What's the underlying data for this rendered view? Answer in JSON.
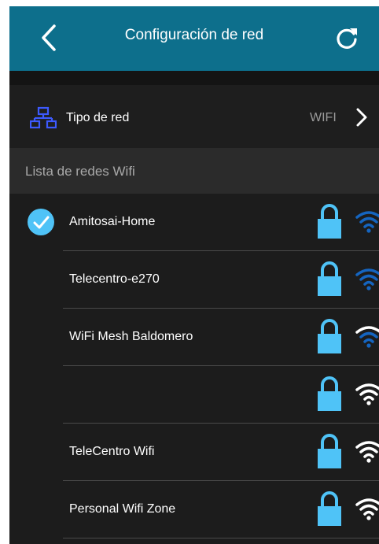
{
  "appbar": {
    "title": "Configuración de red",
    "back_icon": "chevron-left-icon",
    "refresh_icon": "refresh-icon"
  },
  "network_type": {
    "label": "Tipo de red",
    "value": "WIFI",
    "icon": "network-icon"
  },
  "section": {
    "title": "Lista de redes Wifi"
  },
  "colors": {
    "appbar": "#0d6f8c",
    "background": "#1c1c1c",
    "lock": "#4fc3f7",
    "wifi_strong": "#1565c0",
    "wifi_weak": "#ffffff",
    "check": "#4fc3f7"
  },
  "networks": [
    {
      "name": "Amitosai-Home",
      "connected": true,
      "locked": true,
      "signal": "strong"
    },
    {
      "name": "Telecentro-e270",
      "connected": false,
      "locked": true,
      "signal": "strong"
    },
    {
      "name": "WiFi Mesh Baldomero",
      "connected": false,
      "locked": true,
      "signal": "strong"
    },
    {
      "name": "",
      "connected": false,
      "locked": true,
      "signal": "weak"
    },
    {
      "name": "TeleCentro Wifi",
      "connected": false,
      "locked": true,
      "signal": "weak"
    },
    {
      "name": "Personal Wifi Zone",
      "connected": false,
      "locked": true,
      "signal": "weak"
    }
  ]
}
